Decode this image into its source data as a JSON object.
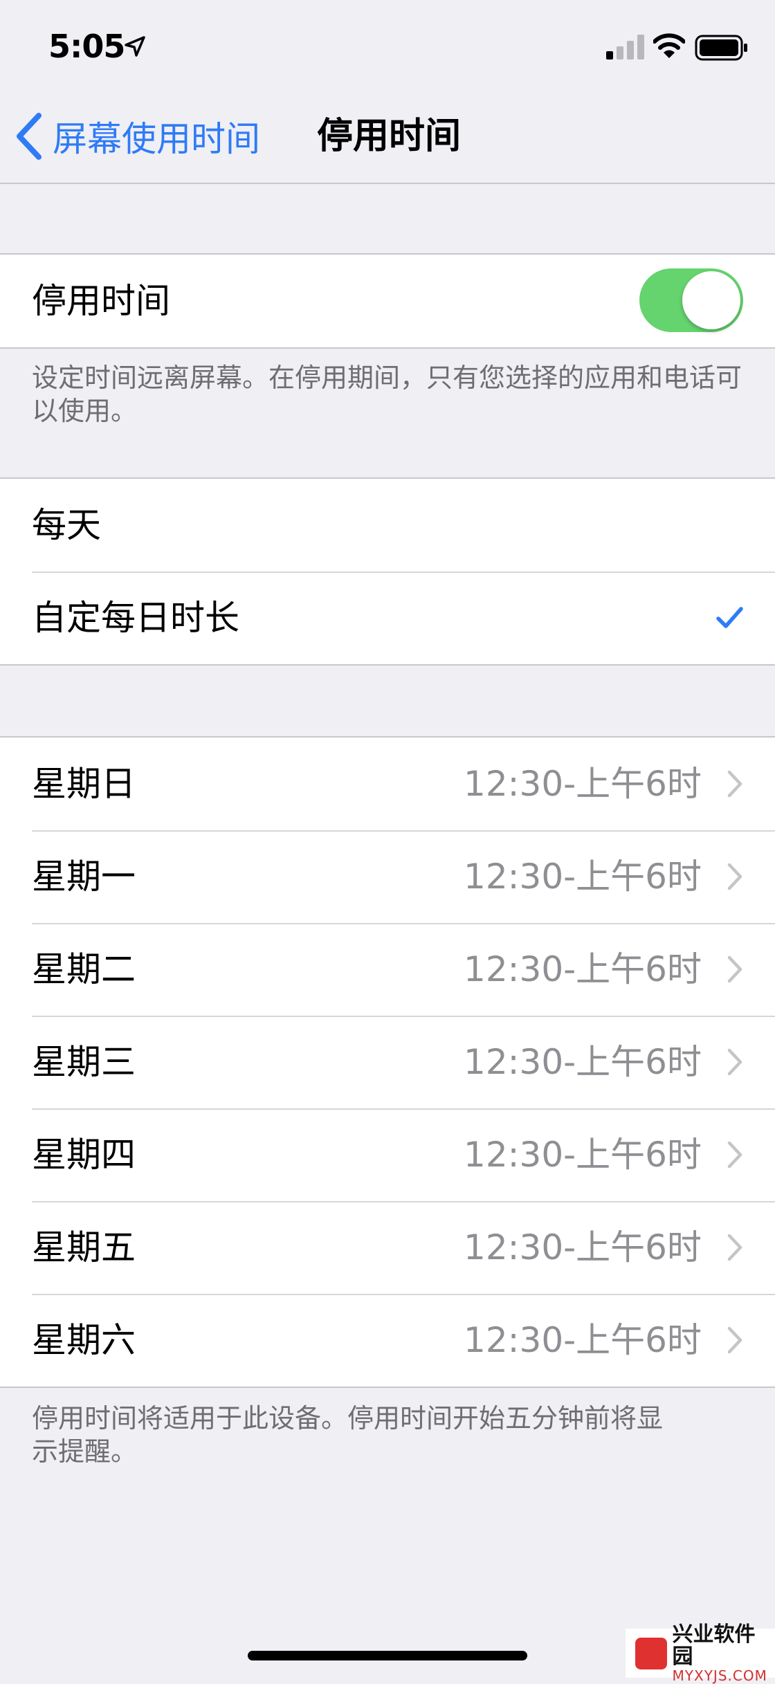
{
  "status_bar": {
    "time": "5:05",
    "icons": [
      "location-arrow-icon",
      "cellular-signal-icon",
      "wifi-icon",
      "battery-icon"
    ]
  },
  "nav": {
    "back_label": "屏幕使用时间",
    "title": "停用时间"
  },
  "downtime": {
    "label": "停用时间",
    "enabled": true,
    "footer": "设定时间远离屏幕。在停用期间，只有您选择的应用和电话可以使用。"
  },
  "schedule": {
    "options": [
      {
        "label": "每天",
        "selected": false
      },
      {
        "label": "自定每日时长",
        "selected": true
      }
    ]
  },
  "days": [
    {
      "day": "星期日",
      "time": "12:30-上午6时"
    },
    {
      "day": "星期一",
      "time": "12:30-上午6时"
    },
    {
      "day": "星期二",
      "time": "12:30-上午6时"
    },
    {
      "day": "星期三",
      "time": "12:30-上午6时"
    },
    {
      "day": "星期四",
      "time": "12:30-上午6时"
    },
    {
      "day": "星期五",
      "time": "12:30-上午6时"
    },
    {
      "day": "星期六",
      "time": "12:30-上午6时"
    }
  ],
  "days_footer": "停用时间将适用于此设备。停用时间开始五分钟前将显示提醒。",
  "watermark": {
    "cn": "兴业软件园",
    "en": "MYXYJS.COM"
  },
  "colors": {
    "accent": "#2f7bf5",
    "toggle_on": "#65d36e",
    "background": "#efeff4",
    "secondary_text": "#8e8e93"
  }
}
